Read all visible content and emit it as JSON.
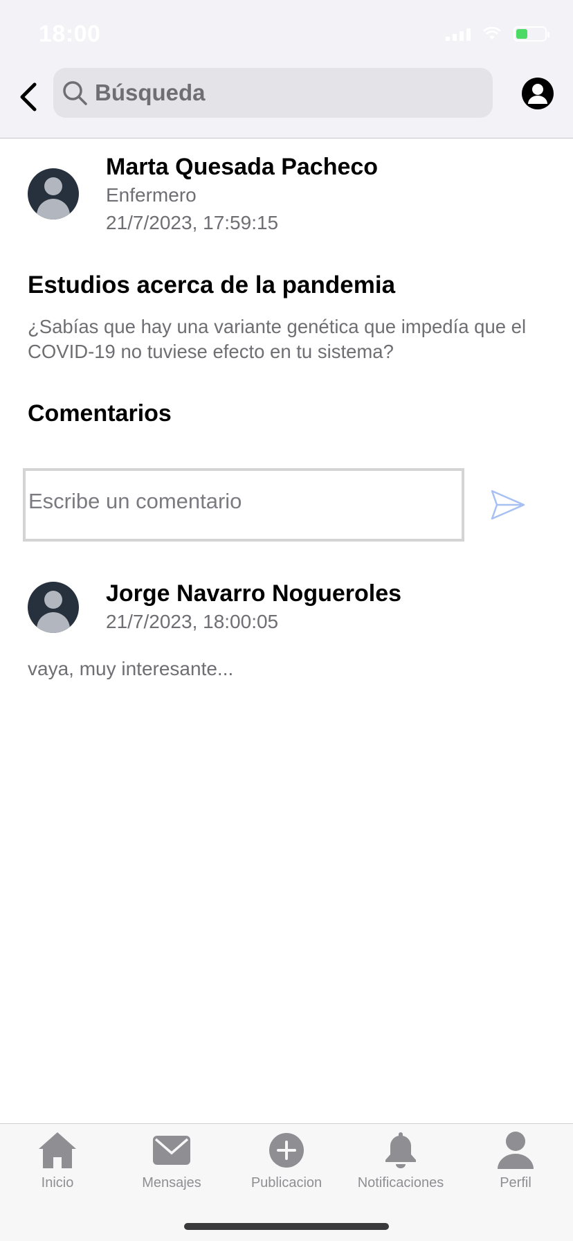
{
  "status_bar": {
    "time": "18:00"
  },
  "header": {
    "search_placeholder": "Búsqueda"
  },
  "post": {
    "author": "Marta Quesada Pacheco",
    "role": "Enfermero",
    "timestamp": "21/7/2023, 17:59:15",
    "title": "Estudios acerca de la pandemia",
    "body": "¿Sabías que hay una variante genética que impedía que el COVID-19 no tuviese efecto en tu sistema?"
  },
  "comments": {
    "heading": "Comentarios",
    "input_placeholder": "Escribe un comentario",
    "items": [
      {
        "author": "Jorge Navarro Nogueroles",
        "timestamp": "21/7/2023, 18:00:05",
        "text": "vaya, muy interesante..."
      }
    ]
  },
  "tab_bar": {
    "items": [
      {
        "label": "Inicio",
        "icon": "home-icon"
      },
      {
        "label": "Mensajes",
        "icon": "mail-icon"
      },
      {
        "label": "Publicacion",
        "icon": "plus-circle-icon"
      },
      {
        "label": "Notificaciones",
        "icon": "bell-icon"
      },
      {
        "label": "Perfil",
        "icon": "person-icon"
      }
    ]
  },
  "colors": {
    "header_bg": "#f2f2f7",
    "avatar_bg": "#27313d",
    "secondary_text": "#6e6e73",
    "send_accent": "#a7c0f4",
    "tab_icon": "#8e8e93"
  }
}
